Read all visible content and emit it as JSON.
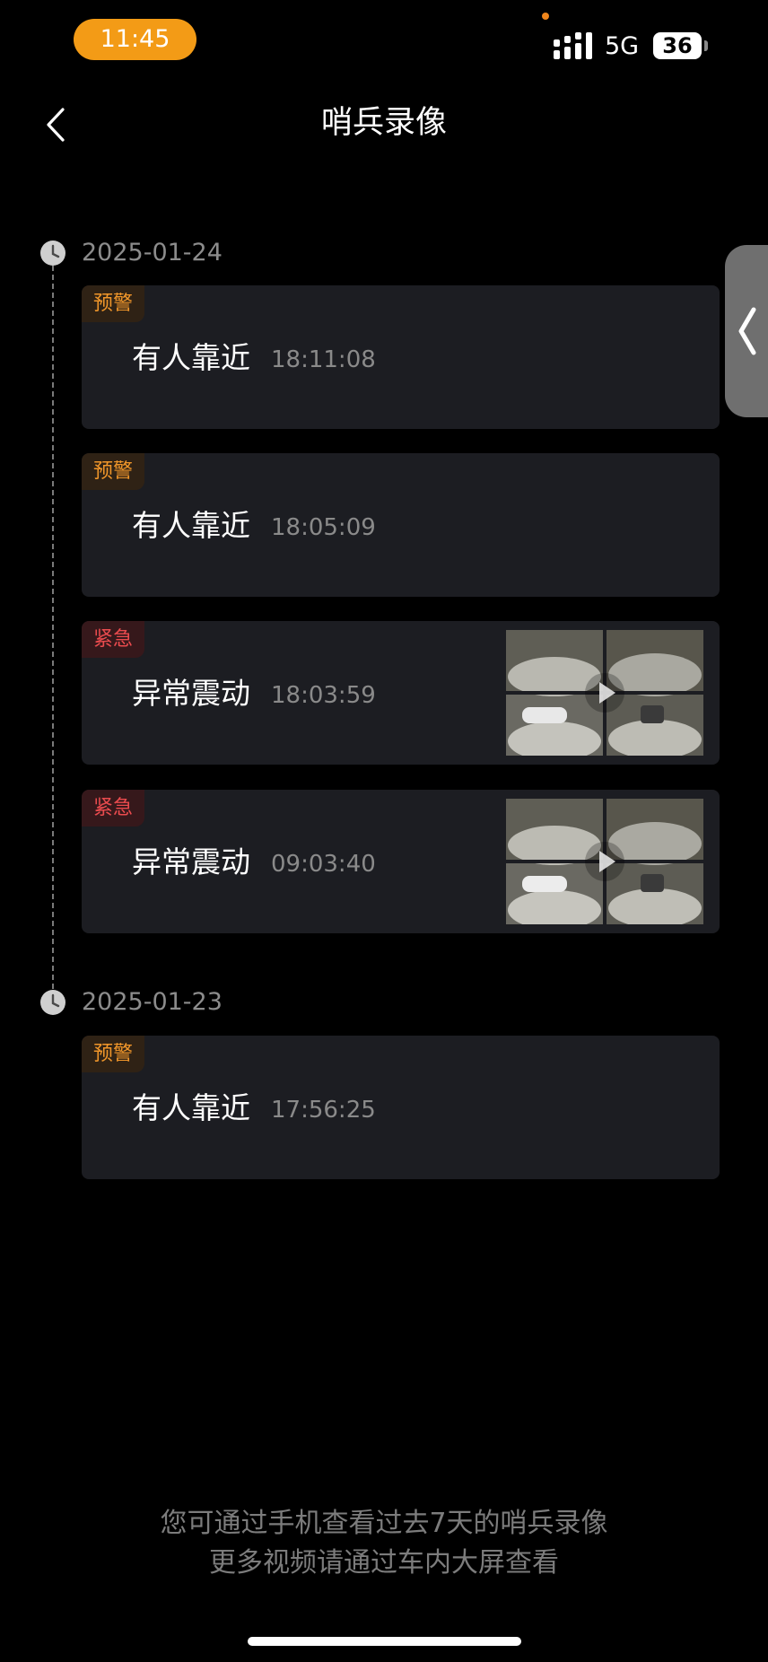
{
  "status_bar": {
    "time": "11:45",
    "network": "5G",
    "battery": "36"
  },
  "header": {
    "title": "哨兵录像",
    "back_icon": "chevron-left-icon"
  },
  "side_handle": {
    "icon": "chevron-left-icon"
  },
  "timeline": {
    "groups": [
      {
        "date": "2025-01-24",
        "events": [
          {
            "tag": "预警",
            "tag_type": "warning",
            "label": "有人靠近",
            "time": "18:11:08",
            "has_thumbnail": false
          },
          {
            "tag": "预警",
            "tag_type": "warning",
            "label": "有人靠近",
            "time": "18:05:09",
            "has_thumbnail": false
          },
          {
            "tag": "紧急",
            "tag_type": "urgent",
            "label": "异常震动",
            "time": "18:03:59",
            "has_thumbnail": true
          },
          {
            "tag": "紧急",
            "tag_type": "urgent",
            "label": "异常震动",
            "time": "09:03:40",
            "has_thumbnail": true
          }
        ]
      },
      {
        "date": "2025-01-23",
        "events": [
          {
            "tag": "预警",
            "tag_type": "warning",
            "label": "有人靠近",
            "time": "17:56:25",
            "has_thumbnail": false
          }
        ]
      }
    ]
  },
  "footer": {
    "line1": "您可通过手机查看过去7天的哨兵录像",
    "line2": "更多视频请通过车内大屏查看"
  },
  "colors": {
    "accent_orange": "#f39b16",
    "warning_text": "#f0962a",
    "urgent_text": "#ea4b4e",
    "card_background": "#1c1d22"
  }
}
